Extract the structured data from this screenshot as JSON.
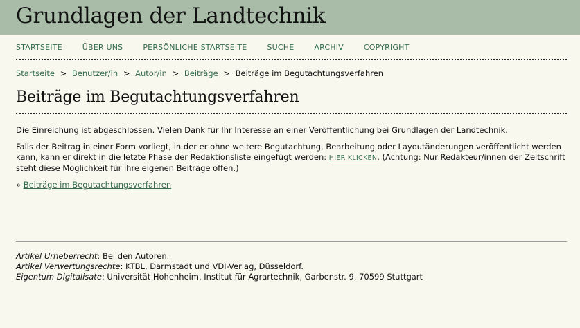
{
  "site": {
    "title": "Grundlagen der Landtechnik"
  },
  "nav": {
    "items": [
      "Startseite",
      "Über uns",
      "Persönliche Startseite",
      "Suche",
      "Archiv",
      "Copyright"
    ]
  },
  "breadcrumb": {
    "items": [
      "Startseite",
      "Benutzer/in",
      "Autor/in",
      "Beiträge"
    ],
    "current": "Beiträge im Begutachtungsverfahren",
    "separator": ">"
  },
  "page": {
    "title": "Beiträge im Begutachtungsverfahren",
    "paragraph1": "Die Einreichung ist abgeschlossen. Vielen Dank für Ihr Interesse an einer Veröffentlichung bei Grundlagen der Landtechnik.",
    "paragraph2_before": "Falls der Beitrag in einer Form vorliegt, in der er ohne weitere Begutachtung, Bearbeitung oder Layoutänderungen veröffentlicht werden kann, kann er direkt in die letzte Phase der Redaktionsliste eingefügt werden: ",
    "paragraph2_link": "HIER KLICKEN",
    "paragraph2_after": ". (Achtung: Nur Redakteur/innen der Zeitschrift steht diese Möglichkeit für ihre eigenen Beiträge offen.)",
    "bullet": "»",
    "back_link": "Beiträge im Begutachtungsverfahren"
  },
  "footer": {
    "lines": [
      {
        "label": "Artikel Urheberrecht",
        "value": ": Bei den Autoren."
      },
      {
        "label": "Artikel Verwertungsrechte",
        "value": ": KTBL, Darmstadt und VDI-Verlag, Düsseldorf."
      },
      {
        "label": "Eigentum Digitalisate",
        "value": ": Universität Hohenheim, Institut für Agrartechnik, Garbenstr. 9, 70599 Stuttgart"
      }
    ]
  },
  "colors": {
    "header_bg": "#a8bca8",
    "link": "#356b4c",
    "page_bg": "#f8f8ee"
  }
}
